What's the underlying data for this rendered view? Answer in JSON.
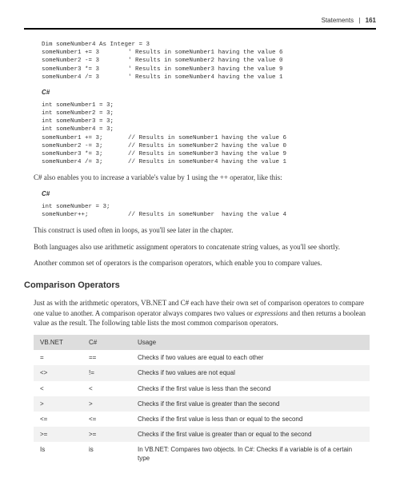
{
  "header": {
    "section": "Statements",
    "divider": "|",
    "page": "161"
  },
  "code_vb": "Dim someNumber4 As Integer = 3\nsomeNumber1 += 3        ' Results in someNumber1 having the value 6\nsomeNumber2 -= 3        ' Results in someNumber2 having the value 0\nsomeNumber3 *= 3        ' Results in someNumber3 having the value 9\nsomeNumber4 /= 3        ' Results in someNumber4 having the value 1",
  "lang_cs": "C#",
  "code_cs": "int someNumber1 = 3;\nint someNumber2 = 3;\nint someNumber3 = 3;\nint someNumber4 = 3;\nsomeNumber1 += 3;       // Results in someNumber1 having the value 6\nsomeNumber2 -= 3;       // Results in someNumber2 having the value 0\nsomeNumber3 *= 3;       // Results in someNumber3 having the value 9\nsomeNumber4 /= 3;       // Results in someNumber4 having the value 1",
  "para1": "C# also enables you to increase a variable's value by 1 using the ++ operator, like this:",
  "lang_cs2": "C#",
  "code_cs2": "int someNumber = 3;\nsomeNumber++;           // Results in someNumber  having the value 4",
  "para2": "This construct is used often in loops, as you'll see later in the chapter.",
  "para3": "Both languages also use arithmetic assignment operators to concatenate string values, as you'll see shortly.",
  "para4": "Another common set of operators is the comparison operators, which enable you to compare values.",
  "section_heading": "Comparison Operators",
  "para5_a": "Just as with the arithmetic operators, VB.NET and C# each have their own set of comparison operators to compare one value to another. A comparison operator always compares two values or ",
  "para5_em": "expressions",
  "para5_b": " and then returns a boolean value as the result. The following table lists the most common comparison operators.",
  "table": {
    "headers": {
      "c1": "VB.NET",
      "c2": "C#",
      "c3": "Usage"
    },
    "rows": [
      {
        "vb": "=",
        "cs": "==",
        "usage": "Checks if two values are equal to each other"
      },
      {
        "vb": "<>",
        "cs": "!=",
        "usage": "Checks if two values are not equal"
      },
      {
        "vb": "<",
        "cs": "<",
        "usage": "Checks if the first value is less than the second"
      },
      {
        "vb": ">",
        "cs": ">",
        "usage": "Checks if the first value is greater than the second"
      },
      {
        "vb": "<=",
        "cs": "<=",
        "usage": "Checks if the first value is less than or equal to the second"
      },
      {
        "vb": ">=",
        "cs": ">=",
        "usage": "Checks if the first value is greater than or equal to the second"
      },
      {
        "vb": "Is",
        "cs": "is",
        "usage": "In VB.NET: Compares two objects. In C#: Checks if a variable is of a certain type"
      }
    ]
  }
}
